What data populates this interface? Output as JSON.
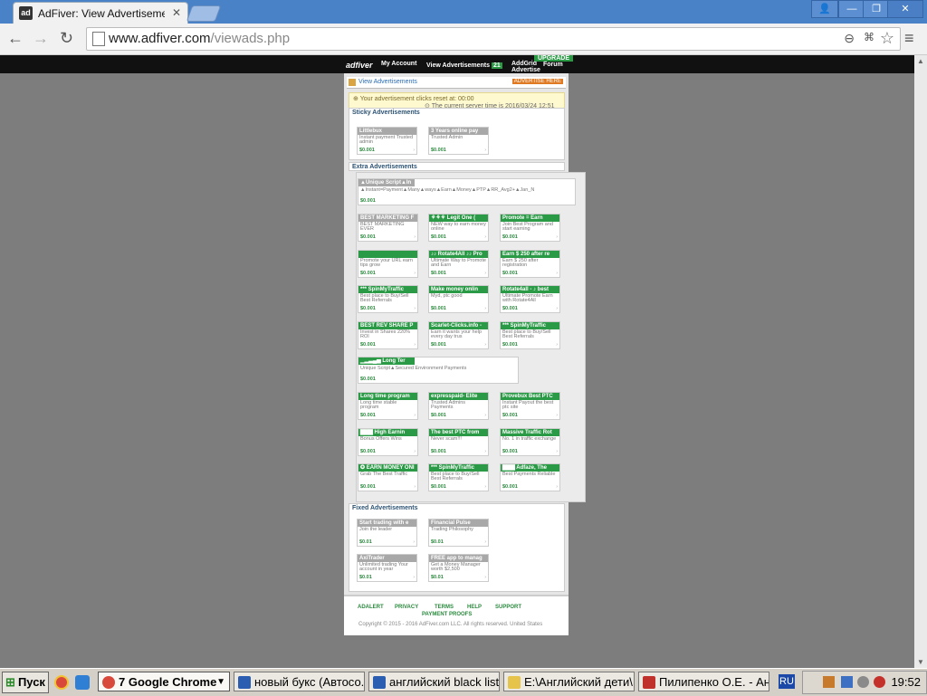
{
  "browser": {
    "tab_title": "AdFiver: View Advertisement",
    "tab_favicon": "ad",
    "url_host": "www.adfiver.com",
    "url_path": "/viewads.php"
  },
  "site_nav": {
    "logo": "adfiver",
    "my_account": "My Account",
    "view_ads": "View Advertisements",
    "view_ads_count": "21",
    "addgrid": "AddGrid Advertise",
    "upgrade": "UPGRADE",
    "forum": "Forum"
  },
  "page": {
    "header_title": "View Advertisements",
    "header_button": "ADVERTISE HERE",
    "notice_reset": "Your advertisement clicks reset at: 00:00",
    "notice_server_time": "The current server time is 2016/03/24 12:51"
  },
  "sticky": {
    "title": "Sticky Advertisements",
    "ads": [
      {
        "title": "Littlebux",
        "desc": "Instant payment Trusted admin",
        "price": "$0.001",
        "green": false
      },
      {
        "title": "3 Years online pay",
        "desc": "Trusted Admin",
        "price": "$0.001",
        "green": false
      }
    ]
  },
  "extra": {
    "title": "Extra Advertisements",
    "wide1": {
      "title": "▲Unique Script▲In",
      "desc": "▲Instant=Payment▲Many▲ways▲Earn▲Money▲PTP▲RR_Avg2+▲Jan_N",
      "price": "$0.001"
    },
    "ads": [
      {
        "title": "BEST MARKETING F",
        "desc": "BEST MARKETING EVER",
        "price": "$0.001",
        "green": false
      },
      {
        "title": "⚘⚘⚘ Legit One (",
        "desc": "NEW way to earn money online",
        "price": "$0.001",
        "green": true
      },
      {
        "title": "Promote = Earn",
        "desc": "Join Best Program and start earning",
        "price": "$0.001",
        "green": true
      },
      {
        "title": "",
        "desc": "Promote your URL earn tips grow",
        "price": "$0.001",
        "green": true
      },
      {
        "title": "♪♪ Rotate4All ♪♪ Pro",
        "desc": "Ultimate Way to Promote and Earn",
        "price": "$0.001",
        "green": true
      },
      {
        "title": "Earn $ 250 after re",
        "desc": "Earn $ 250 after registration",
        "price": "$0.001",
        "green": true
      },
      {
        "title": "*** SpinMyTraffic",
        "desc": "Best place to Buy/Sell Best Referrals",
        "price": "$0.001",
        "green": true
      },
      {
        "title": "Make money onlin",
        "desc": "Myd, ptc good",
        "price": "$0.001",
        "green": true
      },
      {
        "title": "Rotate4all - ♪ best",
        "desc": "Ultimate Promote Earn with Rotate4All",
        "price": "$0.001",
        "green": true
      },
      {
        "title": "BEST REV SHARE P",
        "desc": "Invest in Shares 220% ROI",
        "price": "$0.001",
        "green": true
      },
      {
        "title": "Scarlet-Clicks.info -",
        "desc": "Earn it wants your help every day trus",
        "price": "$0.001",
        "green": true
      },
      {
        "title": "*** SpinMyTraffic",
        "desc": "Best place to Buy/Sell Best Referrals",
        "price": "$0.001",
        "green": true
      }
    ],
    "wide2": {
      "title": "▁▂▃▄▅ Long Ter",
      "desc": "Unique Script▲Secured Environment Payments",
      "price": "$0.001"
    },
    "ads2": [
      {
        "title": "Long time program",
        "desc": "Long time stable program",
        "price": "$0.001",
        "green": true
      },
      {
        "title": "expresspaid- Elite",
        "desc": "Trusted Admins Payments",
        "price": "$0.001",
        "green": true
      },
      {
        "title": "Provebux Best PTC",
        "desc": "Instant Payout the best ptc site",
        "price": "$0.001",
        "green": true
      },
      {
        "title": "▇▇▇ High Earnin",
        "desc": "Bonus Offers Wins",
        "price": "$0.001",
        "green": true
      },
      {
        "title": "The best PTC from",
        "desc": "Never scam!!!",
        "price": "$0.001",
        "green": true
      },
      {
        "title": "Massive Traffic Rot",
        "desc": "No. 1 in traffic exchange",
        "price": "$0.001",
        "green": true
      },
      {
        "title": "✪ EARN MONEY ONI",
        "desc": "Grab The Best Traffic",
        "price": "$0.001",
        "green": true
      },
      {
        "title": "*** SpinMyTraffic",
        "desc": "Best place to Buy/Sell Best Referrals",
        "price": "$0.001",
        "green": true
      },
      {
        "title": "▇▇▇ Adfaze, The",
        "desc": "Best Payments Reliable",
        "price": "$0.001",
        "green": true
      }
    ]
  },
  "fixed": {
    "title": "Fixed Advertisements",
    "ads": [
      {
        "title": "Start trading with e",
        "desc": "Join the leader",
        "price": "$0.01",
        "green": false
      },
      {
        "title": "Financial Pulse",
        "desc": "Trading Philosophy",
        "price": "$0.01",
        "green": false
      },
      {
        "title": "AxiTrader",
        "desc": "Unlimited trading Your account in year",
        "price": "$0.01",
        "green": false
      },
      {
        "title": "FREE app to manag",
        "desc": "Get a Money Manager worth $2,500",
        "price": "$0.01",
        "green": false
      }
    ]
  },
  "footer": {
    "links": [
      "ADALERT",
      "PRIVACY",
      "TERMS",
      "HELP",
      "SUPPORT",
      "PAYMENT PROOFS"
    ],
    "copyright": "Copyright © 2015 - 2016 AdFiver.com LLC. All rights reserved. United States"
  },
  "taskbar": {
    "start": "Пуск",
    "tasks": [
      "7 Google Chrome",
      "новый букс (Автосо...",
      "английский black list",
      "E:\\Английский дети\\...",
      "Пилипенко О.Е. - Ан..."
    ],
    "lang": "RU",
    "clock": "19:52"
  }
}
